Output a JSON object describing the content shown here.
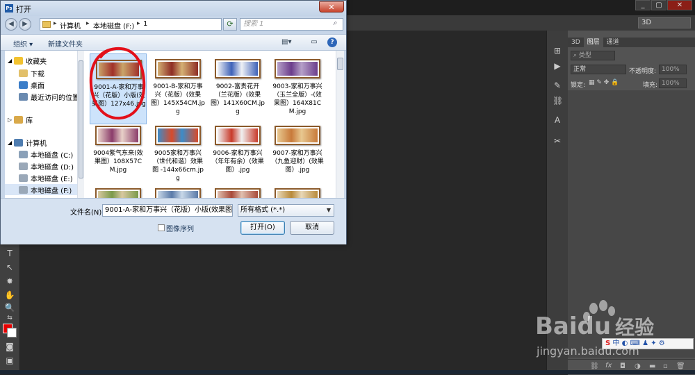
{
  "ps": {
    "window_buttons": [
      "_",
      "▢",
      "✕"
    ],
    "option_bar_right": "3D",
    "panel_tabs": [
      "3D",
      "图层",
      "通道"
    ],
    "panel_active_tab": "图层",
    "kind_label": "类型",
    "blend_mode": "正常",
    "opacity_label": "不透明度:",
    "opacity_value": "100%",
    "lock_label": "锁定:",
    "fill_label": "填充:",
    "fill_value": "100%",
    "footer_icons": [
      "link-icon",
      "fx-icon",
      "mask-icon",
      "adjustment-icon",
      "folder-icon",
      "new-layer-icon",
      "trash-icon"
    ],
    "foreground_color": "#e30000",
    "background_color": "#ffffff"
  },
  "dialog": {
    "title": "打开",
    "app_icon_text": "Ps",
    "close_glyph": "✕",
    "breadcrumbs": [
      "计算机",
      "本地磁盘 (F:)",
      "1"
    ],
    "search_placeholder": "搜索 1",
    "commands": {
      "organize": "组织 ▾",
      "new_folder": "新建文件夹"
    },
    "nav": {
      "favorites": "收藏夹",
      "downloads": "下载",
      "desktop": "桌面",
      "recent": "最近访问的位置",
      "library": "库",
      "computer": "计算机",
      "drive_c": "本地磁盘 (C:)",
      "drive_d": "本地磁盘 (D:)",
      "drive_e": "本地磁盘 (E:)",
      "drive_f": "本地磁盘 (F:)"
    },
    "files": [
      {
        "name": "9001-A-家和万事兴（花版）小版(效果图）127x46.jpg",
        "color_a": "#c9a46a",
        "color_b": "#a0302a",
        "selected": true
      },
      {
        "name": "9001-B-家和万事兴（花版）(效果图）145X54CM.jpg",
        "color_a": "#d4b074",
        "color_b": "#8e2d25"
      },
      {
        "name": "9002-富贵花开（兰花版）(效果图）141X60CM.jpg",
        "color_a": "#eef0f5",
        "color_b": "#3f62b8"
      },
      {
        "name": "9003-家和万事兴（玉兰全版）-(效果图）164X81CM.jpg",
        "color_a": "#b5a0c8",
        "color_b": "#6c3d8c"
      },
      {
        "name": "9004紫气东来(效果图）108X57CM.jpg",
        "color_a": "#e8d0c8",
        "color_b": "#8b3c6a"
      },
      {
        "name": "9005家和万事兴（世代和谐）效果图 -144x66cm.jpg",
        "color_a": "#3c8cc8",
        "color_b": "#d84a2a"
      },
      {
        "name": "9006-家和万事兴（年年有余）(效果图）.jpg",
        "color_a": "#f0f0f0",
        "color_b": "#c83a2a"
      },
      {
        "name": "9007-家和万事兴（九鱼迎财）(效果图）.jpg",
        "color_a": "#e8c890",
        "color_b": "#c87a3a"
      },
      {
        "name": "",
        "color_a": "#d8c8a0",
        "color_b": "#7a9a4a"
      },
      {
        "name": "",
        "color_a": "#c8d8e8",
        "color_b": "#5a7aa8"
      },
      {
        "name": "",
        "color_a": "#e0c0b0",
        "color_b": "#a84a3a"
      },
      {
        "name": "",
        "color_a": "#e8d8b8",
        "color_b": "#b88a3a"
      }
    ],
    "filename_label": "文件名(N):",
    "filename_value": "9001-A-家和万事兴（花版）小版(效果图）1",
    "filter_value": "所有格式 (*.*)",
    "image_sequence_label": "图像序列",
    "open_button": "打开(O)",
    "cancel_button": "取消"
  },
  "watermark": {
    "brand": "Bai",
    "brand_mid": "du",
    "brand_cn": "经验",
    "url": "jingyan.baidu.com"
  },
  "ime": "中 ◐ ⌨ ♟ ✦ ⚙"
}
